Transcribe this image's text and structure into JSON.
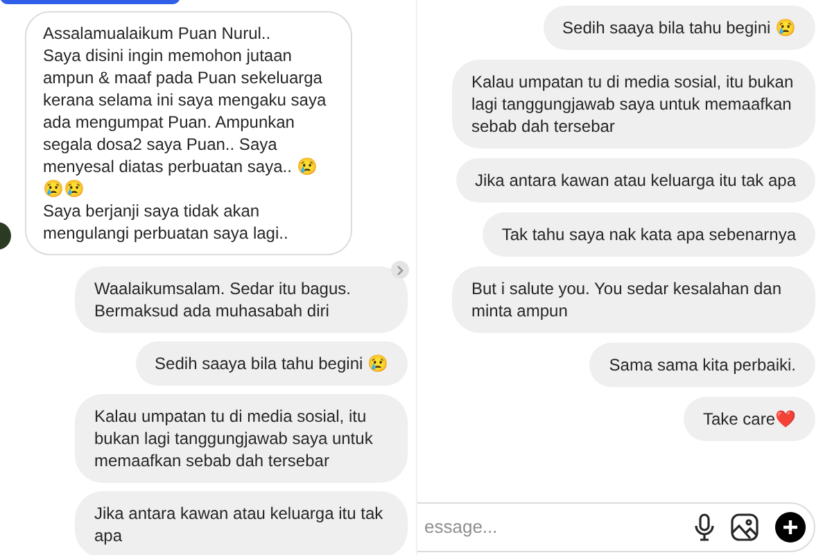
{
  "left_panel": {
    "messages": [
      {
        "kind": "received",
        "text": "Assalamualaikum Puan Nurul..\nSaya disini ingin memohon jutaan ampun & maaf pada Puan sekeluarga kerana selama ini saya mengaku saya ada mengumpat Puan. Ampunkan segala dosa2 saya Puan.. Saya menyesal diatas perbuatan saya.. 😢 😢😢\nSaya berjanji saya tidak akan mengulangi perbuatan saya lagi.."
      },
      {
        "kind": "sent",
        "text": "Waalaikumsalam. Sedar itu bagus. Bermaksud ada muhasabah diri"
      },
      {
        "kind": "sent",
        "text": "Sedih saaya bila tahu begini 😢"
      },
      {
        "kind": "sent",
        "text": "Kalau umpatan tu di media sosial, itu bukan lagi tanggungjawab saya untuk memaafkan sebab dah tersebar"
      },
      {
        "kind": "sent",
        "text": "Jika antara kawan atau keluarga itu tak apa"
      }
    ]
  },
  "right_panel": {
    "messages": [
      {
        "kind": "sent",
        "text": "Sedih saaya bila tahu begini 😢"
      },
      {
        "kind": "sent",
        "text": "Kalau umpatan tu di media sosial, itu bukan lagi tanggungjawab saya untuk memaafkan sebab dah tersebar"
      },
      {
        "kind": "sent",
        "text": "Jika antara kawan atau keluarga itu tak apa"
      },
      {
        "kind": "sent",
        "text": "Tak tahu saya nak kata apa sebenarnya"
      },
      {
        "kind": "sent",
        "text": "But i salute you. You sedar kesalahan dan minta ampun"
      },
      {
        "kind": "sent",
        "text": "Sama sama kita perbaiki."
      },
      {
        "kind": "sent",
        "text": "Take care❤️"
      }
    ],
    "composer": {
      "placeholder": "essage..."
    }
  }
}
